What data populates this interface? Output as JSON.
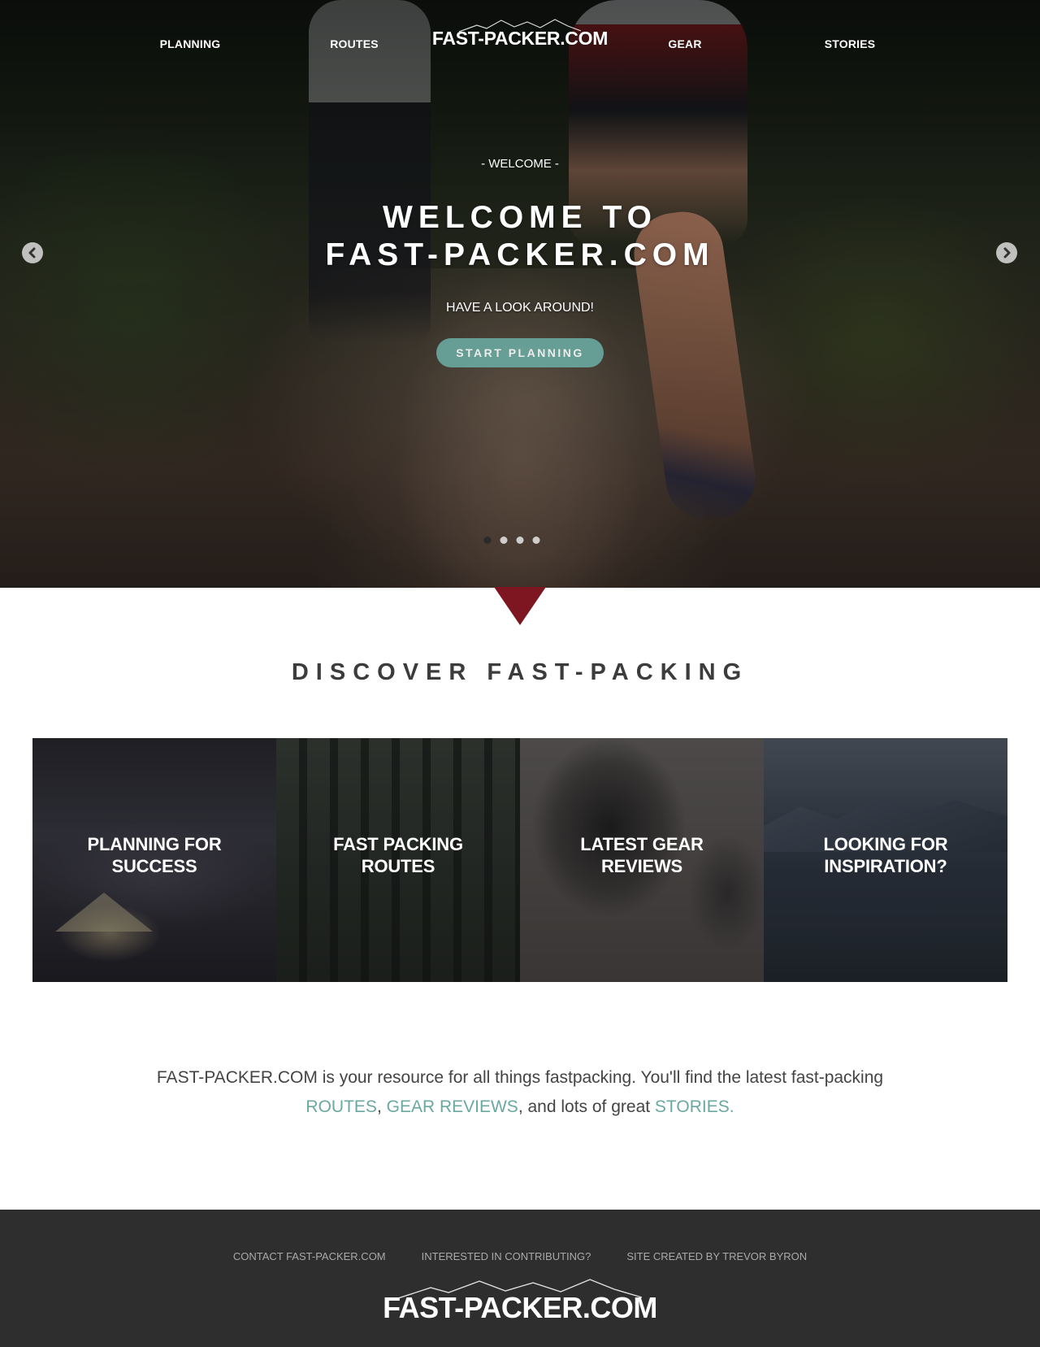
{
  "nav": {
    "links": [
      "PLANNING",
      "ROUTES",
      "GEAR",
      "STORIES"
    ],
    "logo": "FAST-PACKER.COM"
  },
  "hero": {
    "eyebrow": "- WELCOME -",
    "title_line1": "WELCOME TO",
    "title_line2": "FAST-PACKER.COM",
    "subtitle": "HAVE A LOOK AROUND!",
    "cta_label": "START PLANNING",
    "prev_icon": "chevron-left-circle-icon",
    "next_icon": "chevron-right-circle-icon",
    "slides_total": 4,
    "active_slide": 1
  },
  "discover": {
    "heading": "DISCOVER FAST-PACKING",
    "tiles": [
      {
        "line1": "PLANNING FOR",
        "line2": "SUCCESS"
      },
      {
        "line1": "FAST PACKING",
        "line2": "ROUTES"
      },
      {
        "line1": "LATEST GEAR",
        "line2": "REVIEWS"
      },
      {
        "line1": "LOOKING FOR",
        "line2": "INSPIRATION?"
      }
    ]
  },
  "intro": {
    "text_1": "FAST-PACKER.COM is your resource for all things fastpacking. You'll find the latest fast-packing ",
    "link_routes": "ROUTES",
    "sep": ", ",
    "link_gear": "GEAR REVIEWS",
    "text_2": ", and lots of great ",
    "link_stories": "STORIES."
  },
  "footer": {
    "links": [
      "CONTACT FAST-PACKER.COM",
      "INTERESTED IN CONTRIBUTING?",
      "SITE CREATED BY TREVOR BYRON"
    ],
    "logo": "FAST-PACKER.COM"
  },
  "colors": {
    "accent": "#6aa8a0",
    "pointer": "#7d1620",
    "footer_bg": "#2e2e2e",
    "heading": "#3c3c3c"
  }
}
